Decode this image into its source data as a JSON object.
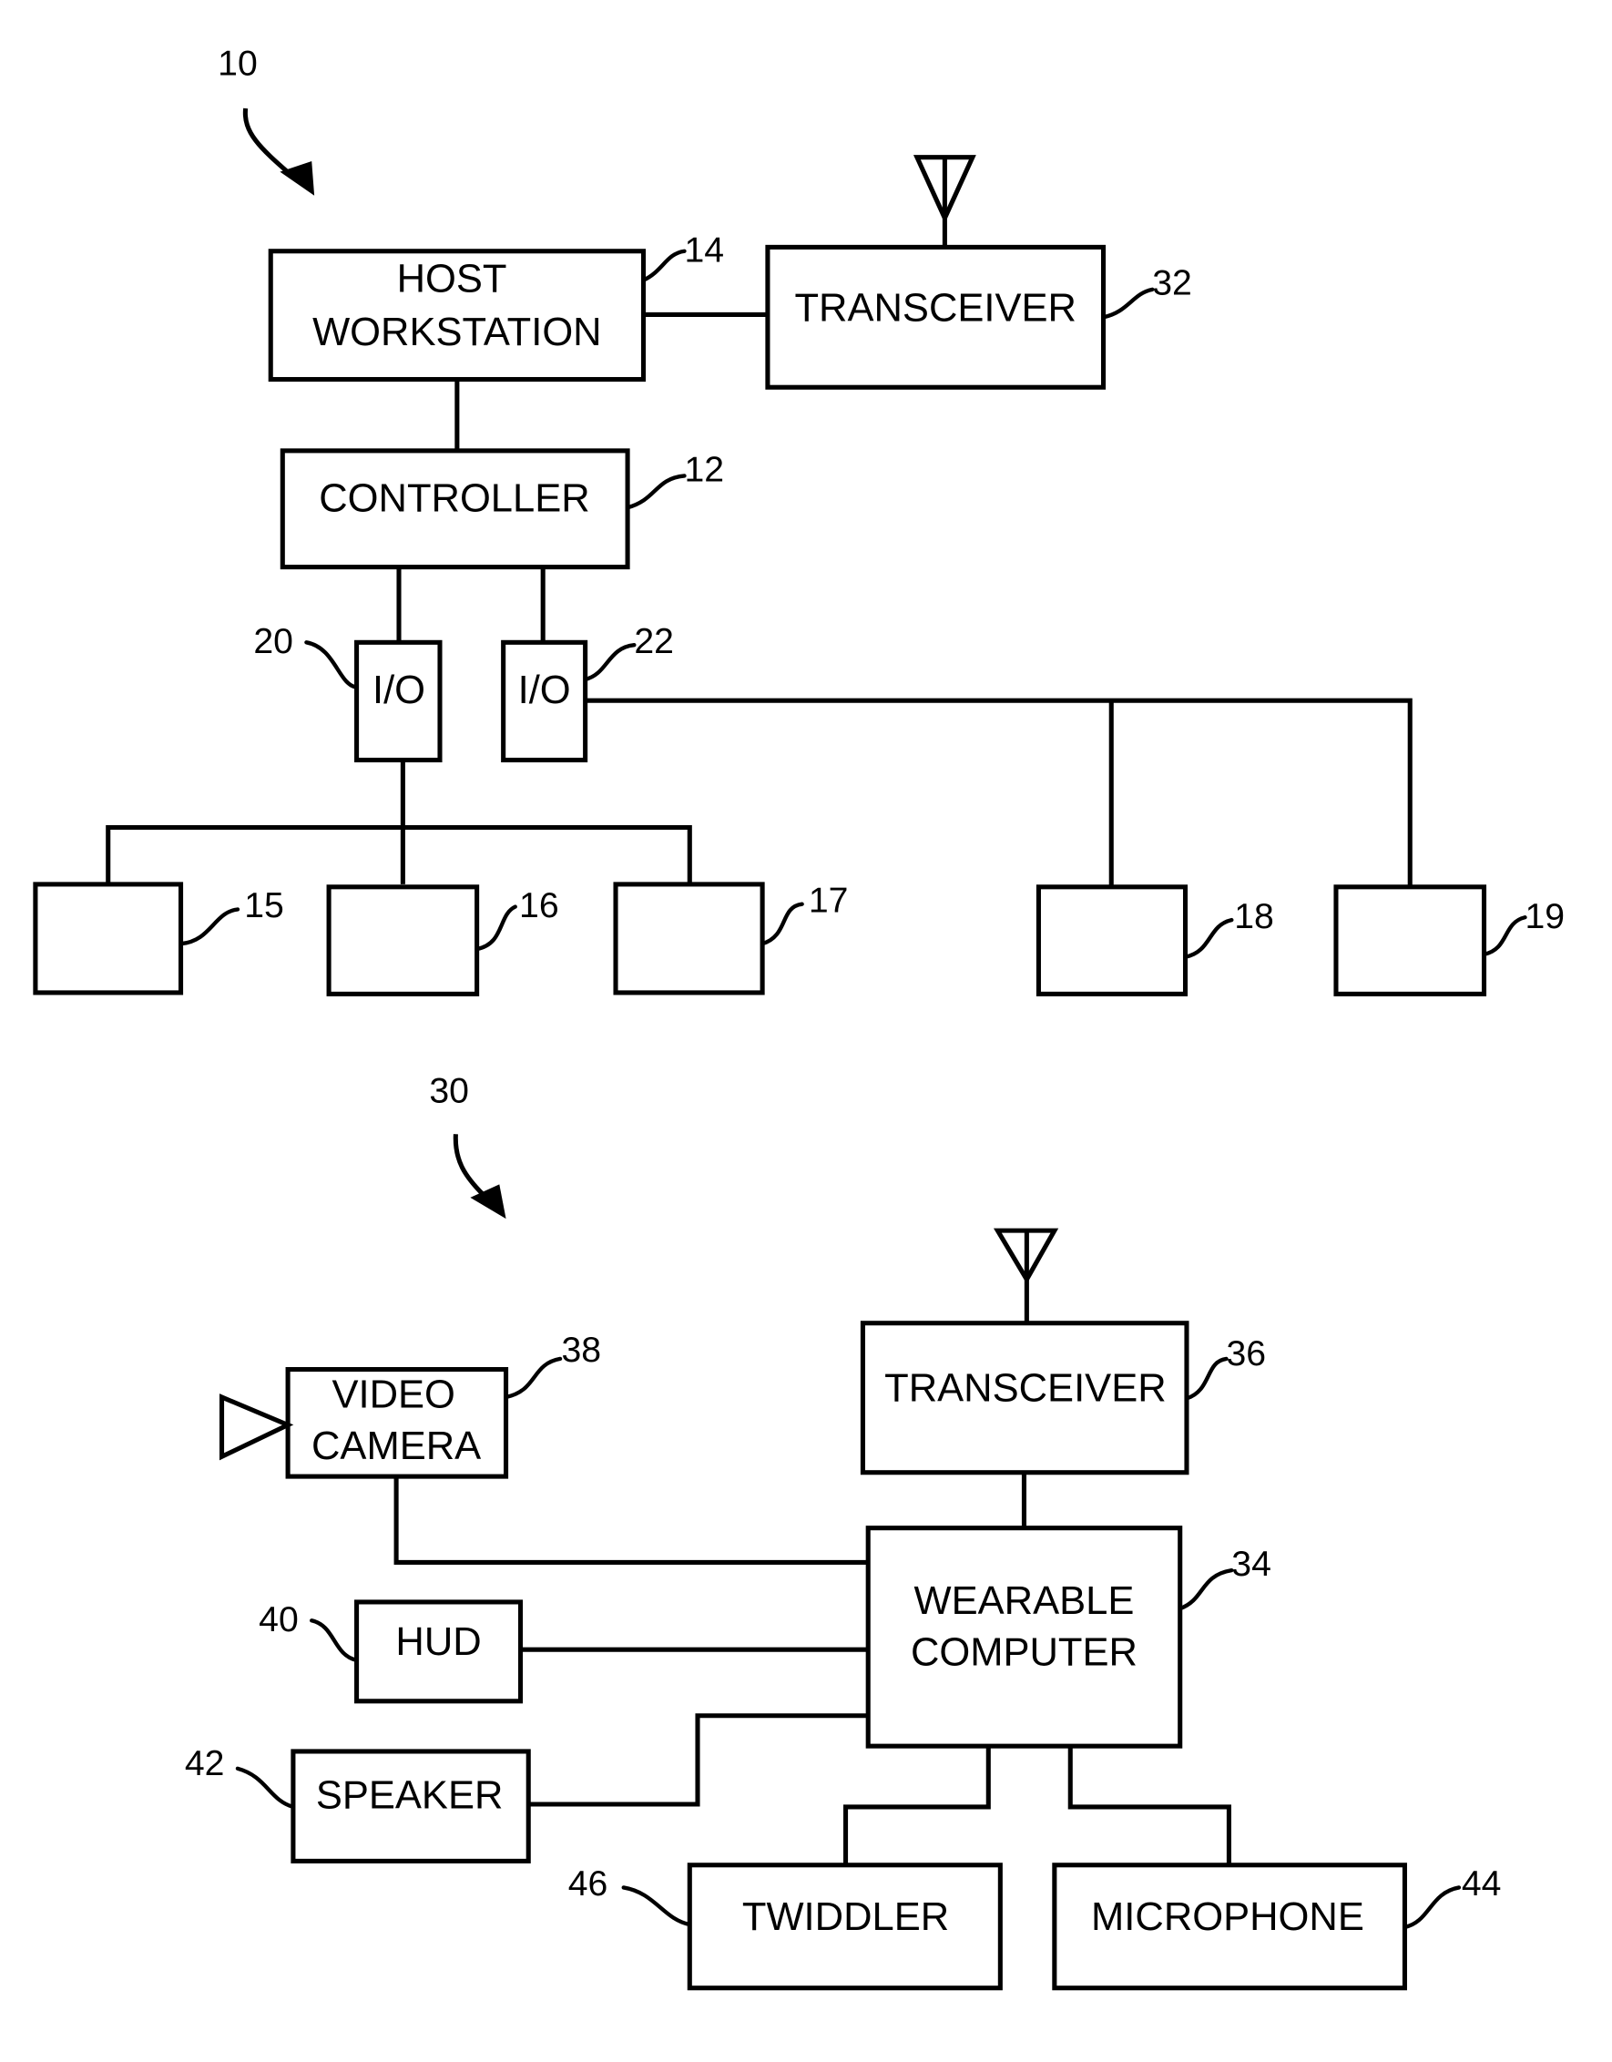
{
  "figure": {
    "system_ref": "10",
    "mobile_ref": "30",
    "stroke_color": "#000000",
    "background_color": "#ffffff"
  },
  "blocks": {
    "host_workstation": {
      "line1": "HOST",
      "line2": "WORKSTATION",
      "ref": "14"
    },
    "transceiver_host": {
      "label": "TRANSCEIVER",
      "ref": "32"
    },
    "controller": {
      "label": "CONTROLLER",
      "ref": "12"
    },
    "io_left": {
      "label": "I/O",
      "ref": "20"
    },
    "io_right": {
      "label": "I/O",
      "ref": "22"
    },
    "device_15": {
      "ref": "15"
    },
    "device_16": {
      "ref": "16"
    },
    "device_17": {
      "ref": "17"
    },
    "device_18": {
      "ref": "18"
    },
    "device_19": {
      "ref": "19"
    },
    "transceiver_mobile": {
      "label": "TRANSCEIVER",
      "ref": "36"
    },
    "video_camera": {
      "line1": "VIDEO",
      "line2": "CAMERA",
      "ref": "38"
    },
    "wearable_computer": {
      "line1": "WEARABLE",
      "line2": "COMPUTER",
      "ref": "34"
    },
    "hud": {
      "label": "HUD",
      "ref": "40"
    },
    "speaker": {
      "label": "SPEAKER",
      "ref": "42"
    },
    "twiddler": {
      "label": "TWIDDLER",
      "ref": "46"
    },
    "microphone": {
      "label": "MICROPHONE",
      "ref": "44"
    }
  }
}
